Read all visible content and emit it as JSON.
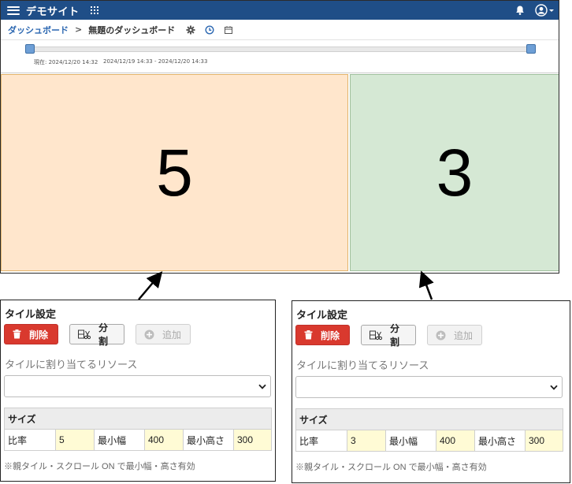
{
  "header": {
    "site_title": "デモサイト"
  },
  "breadcrumb": {
    "link": "ダッシュボード",
    "separator": ">",
    "current": "無題のダッシュボード"
  },
  "slider": {
    "now_label": "現在: 2024/12/20 14:32",
    "range_label": "2024/12/19 14:33 - 2024/12/20 14:33"
  },
  "tiles": [
    {
      "value": "5",
      "color": "#ffe6cc"
    },
    {
      "value": "3",
      "color": "#d5e8d4"
    }
  ],
  "panels": [
    {
      "title": "タイル設定",
      "delete_label": "削除",
      "split_label": "分割",
      "add_label": "追加",
      "resource_label": "タイルに割り当てるリソース",
      "resource_value": "",
      "size_header": "サイズ",
      "ratio_label": "比率",
      "ratio_value": "5",
      "min_width_label": "最小幅",
      "min_width_value": "400",
      "min_height_label": "最小高さ",
      "min_height_value": "300",
      "note": "※親タイル・スクロール ON で最小幅・高さ有効"
    },
    {
      "title": "タイル設定",
      "delete_label": "削除",
      "split_label": "分割",
      "add_label": "追加",
      "resource_label": "タイルに割り当てるリソース",
      "resource_value": "",
      "size_header": "サイズ",
      "ratio_label": "比率",
      "ratio_value": "3",
      "min_width_label": "最小幅",
      "min_width_value": "400",
      "min_height_label": "最小高さ",
      "min_height_value": "300",
      "note": "※親タイル・スクロール ON で最小幅・高さ有効"
    }
  ],
  "icons": {
    "menu": "hamburger-icon",
    "apps": "apps-grid-icon",
    "notifications": "bell-icon",
    "user": "user-circle-icon",
    "settings": "gear-icon",
    "history": "clock-icon",
    "calendar": "calendar-icon",
    "delete": "trash-icon",
    "split": "split-icon",
    "add": "plus-circle-icon"
  },
  "colors": {
    "header_bg": "#1f4e87",
    "delete_button": "#d9392e",
    "link": "#2b67b1"
  }
}
